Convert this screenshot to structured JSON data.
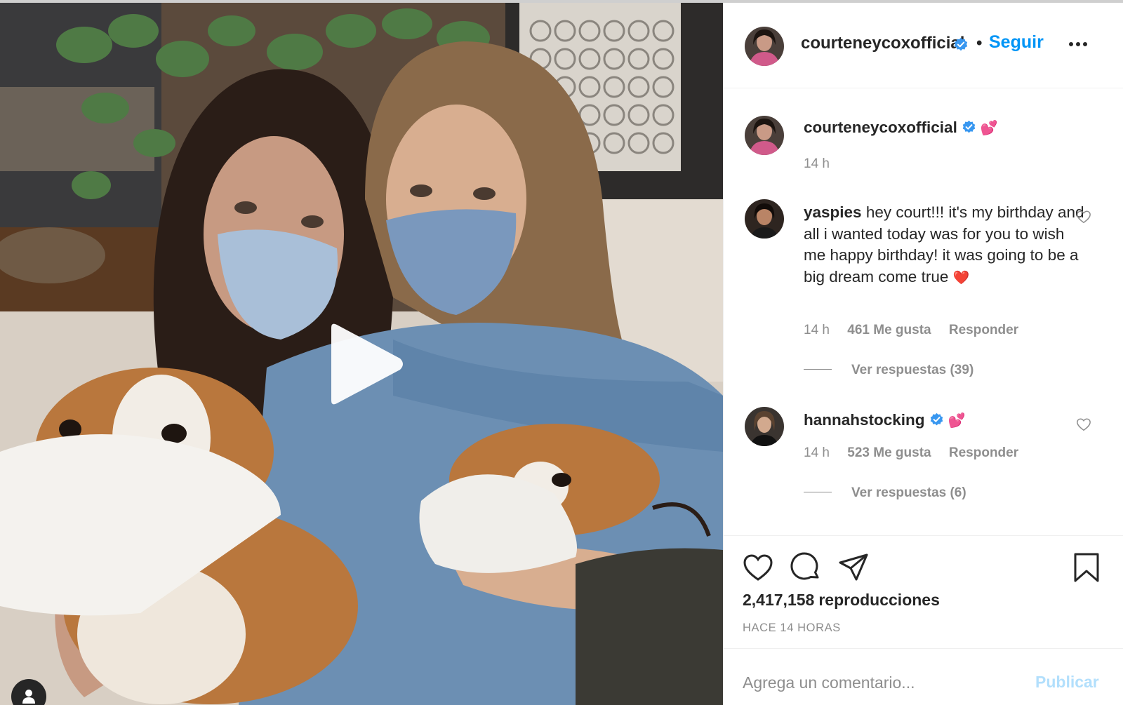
{
  "post": {
    "author": "courteneycoxofficial",
    "follow_label": "Seguir",
    "separator": "•",
    "caption_emoji": "💕",
    "caption_time": "14 h"
  },
  "comments": [
    {
      "user": "yaspies",
      "text": "hey court!!! it's my birthday and all i wanted today was for you to wish me happy birthday! it was going to be a big dream come true",
      "emoji": "❤️",
      "time": "14 h",
      "likes": "461 Me gusta",
      "reply": "Responder",
      "view_replies": "Ver respuestas (39)"
    },
    {
      "user": "hannahstocking",
      "verified": true,
      "emoji": "💕",
      "time": "14 h",
      "likes": "523 Me gusta",
      "reply": "Responder",
      "view_replies": "Ver respuestas (6)"
    }
  ],
  "stats": {
    "views_number": "2,417,158",
    "views_label": "reproducciones",
    "time_ago": "HACE 14 HORAS"
  },
  "comment_box": {
    "placeholder": "Agrega un comentario...",
    "publish_label": "Publicar"
  },
  "colors": {
    "accent": "#0095f6",
    "verified": "#3897f0",
    "muted": "#8e8e8e",
    "publish_disabled": "#b2dffc"
  },
  "icons": {
    "play": "play-icon",
    "user_tag": "user-tag-icon",
    "more": "more-options-icon",
    "verified": "verified-badge-icon",
    "like": "heart-icon",
    "comment": "comment-icon",
    "share": "share-icon",
    "save": "bookmark-icon"
  }
}
